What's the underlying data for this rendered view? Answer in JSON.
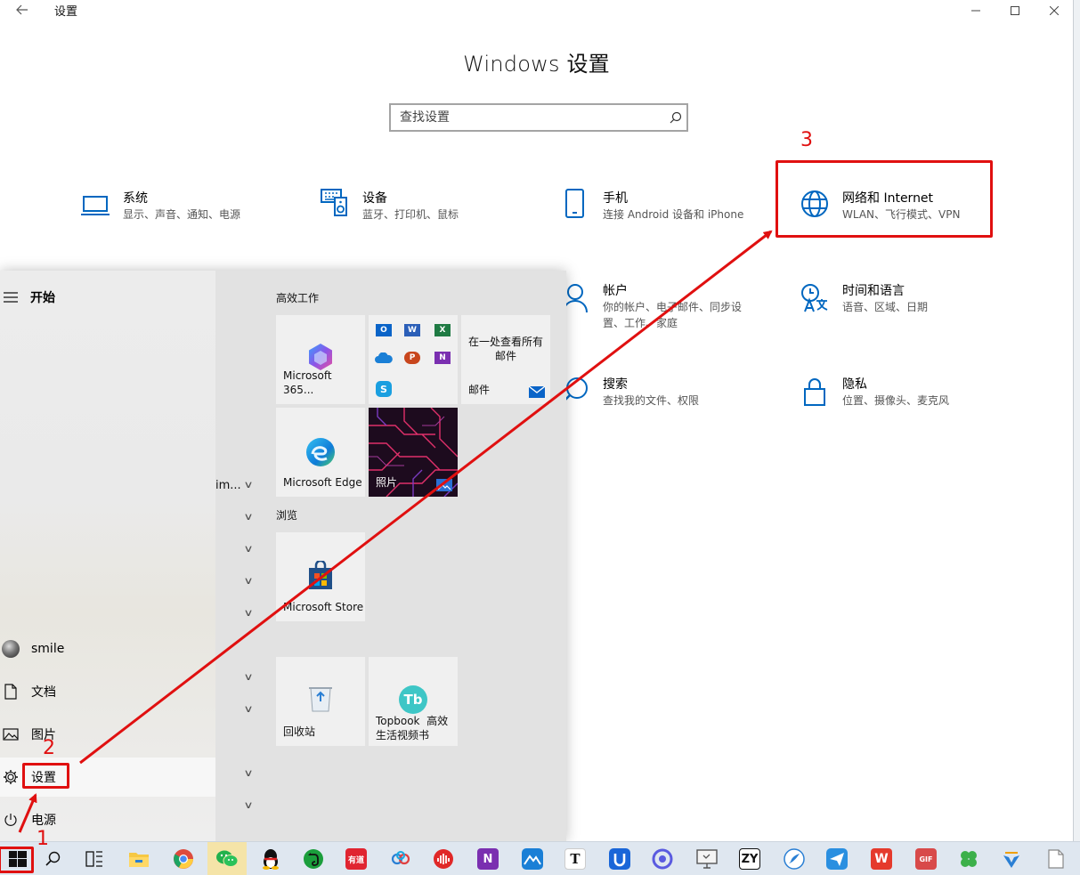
{
  "window": {
    "title": "设置",
    "heading": "Windows 设置",
    "controls": {
      "minimize": "—",
      "maximize": "☐",
      "close": "✕"
    }
  },
  "search": {
    "placeholder": "查找设置"
  },
  "categories": [
    {
      "id": "system",
      "title": "系统",
      "subtitle": "显示、声音、通知、电源",
      "icon": "laptop-icon"
    },
    {
      "id": "devices",
      "title": "设备",
      "subtitle": "蓝牙、打印机、鼠标",
      "icon": "keyboard-speaker-icon"
    },
    {
      "id": "phone",
      "title": "手机",
      "subtitle": "连接 Android 设备和 iPhone",
      "icon": "phone-icon"
    },
    {
      "id": "network",
      "title": "网络和 Internet",
      "subtitle": "WLAN、飞行模式、VPN",
      "icon": "globe-icon"
    },
    {
      "id": "accounts",
      "title": "帐户",
      "subtitle": "你的帐户、电子邮件、同步设置、工作、家庭",
      "icon": "person-icon"
    },
    {
      "id": "time",
      "title": "时间和语言",
      "subtitle": "语音、区域、日期",
      "icon": "clock-language-icon"
    },
    {
      "id": "search",
      "title": "搜索",
      "subtitle": "查找我的文件、权限",
      "icon": "magnifier-icon"
    },
    {
      "id": "privacy",
      "title": "隐私",
      "subtitle": "位置、摄像头、麦克风",
      "icon": "lock-icon"
    }
  ],
  "annotations": {
    "step1": "1",
    "step2": "2",
    "step3": "3"
  },
  "start_menu": {
    "header": "开始",
    "user": "smile",
    "documents": "文档",
    "pictures": "图片",
    "settings": "设置",
    "power": "电源",
    "truncated_app": "im...",
    "groups": {
      "work": "高效工作",
      "browse": "浏览"
    },
    "tiles": {
      "m365": "Microsoft 365...",
      "mail_promo": "在一处查看所有邮件",
      "mail": "邮件",
      "edge": "Microsoft Edge",
      "photos": "照片",
      "store": "Microsoft Store",
      "recycle": "回收站",
      "topbook_1": "Topbook  高效",
      "topbook_2": "生活视频书"
    },
    "office_badges": [
      "O",
      "W",
      "X",
      "",
      "P",
      "N",
      "S"
    ]
  },
  "taskbar": {
    "badges": {
      "youdao": "有道",
      "onenote": "N",
      "typora": "T",
      "zy": "ZY",
      "wps": "W",
      "gif": "GIF"
    }
  },
  "colors": {
    "accent": "#0067c0",
    "annotation_red": "#e01010",
    "taskbar": "#dfe7f0"
  }
}
